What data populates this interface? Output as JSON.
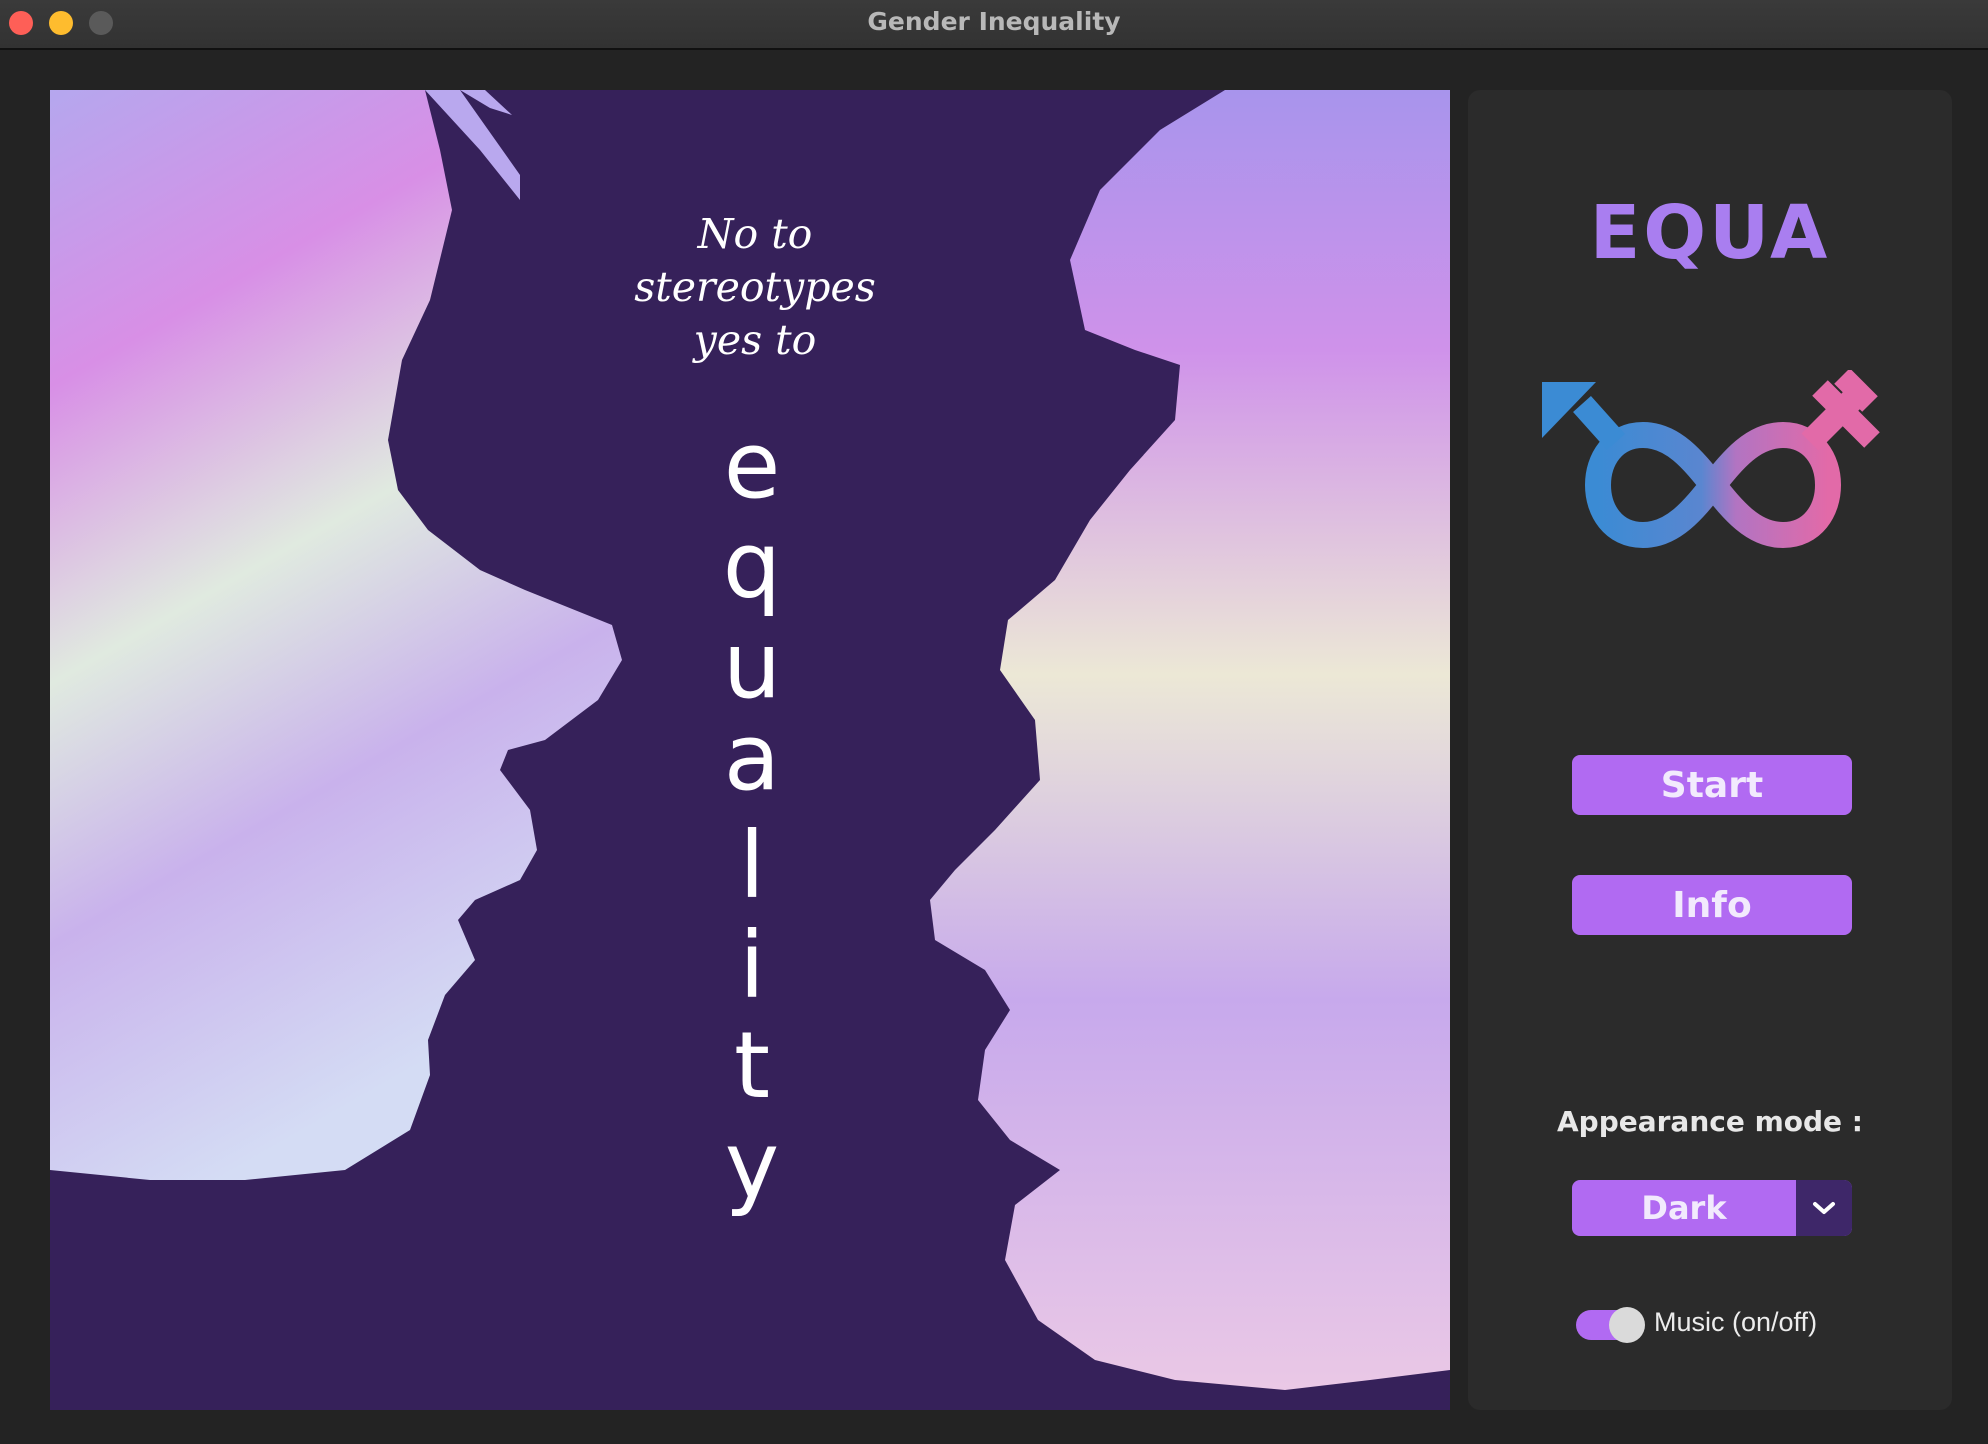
{
  "window": {
    "title": "Gender Inequality"
  },
  "poster": {
    "slogan_lines": [
      "No to",
      "stereotypes",
      "yes to"
    ],
    "big_word_letters": [
      "e",
      "q",
      "u",
      "a",
      "l",
      "i",
      "t",
      "y"
    ]
  },
  "panel": {
    "app_title": "EQUA",
    "logo_icon": "gender-equality-infinity-icon",
    "start_label": "Start",
    "info_label": "Info",
    "appearance_label": "Appearance mode :",
    "appearance_value": "Dark",
    "music_label": "Music (on/off)",
    "music_on": true
  },
  "colors": {
    "accent": "#b16af2",
    "title_purple": "#a97ef0",
    "poster_background": "#36215a",
    "male_blue": "#3b8bd4",
    "female_pink": "#e26aa8"
  }
}
